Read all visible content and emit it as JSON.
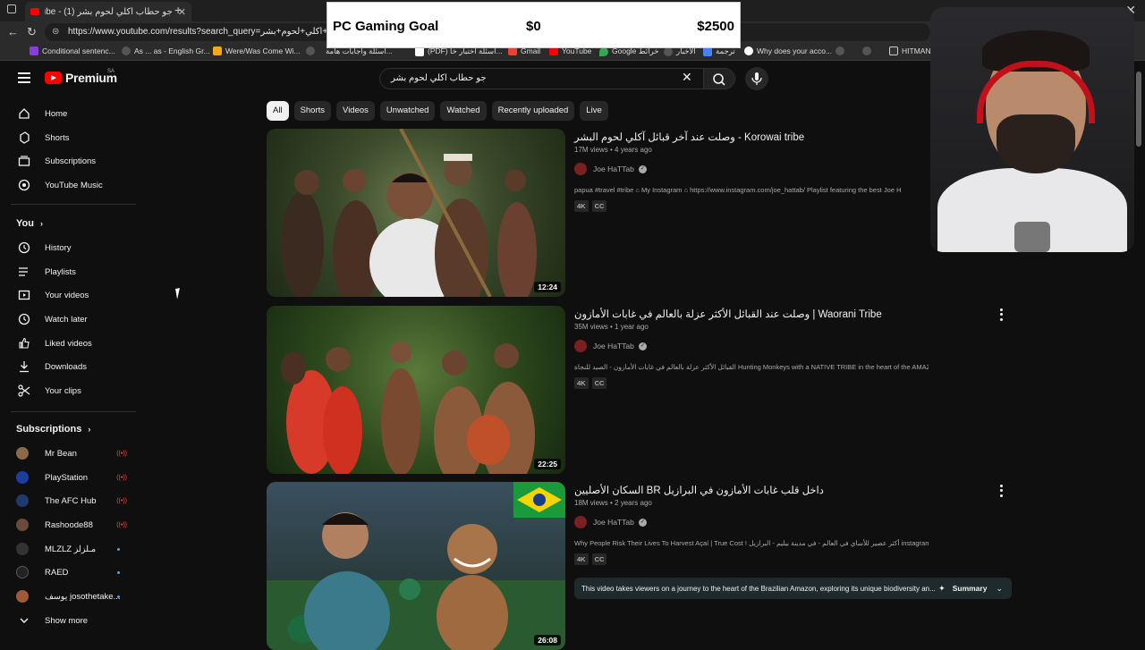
{
  "browser": {
    "tab_title": "جو حطاب اكلي لحوم بشر (1) - YouTube",
    "url": "https://www.youtube.com/results?search_query=جو+حطاب+اكلي+لحوم+بشر",
    "bookmarks": [
      "Conditional sentenc...",
      "As ... as - English Gr...",
      "Were/Was Come Wi...",
      "اسئلة واجابات هامة...",
      "(PDF) اسئلة اختبار خا...",
      "Gmail",
      "YouTube",
      "Google خرائط",
      "الأخبار",
      "ترجمة",
      "Why does your acco...",
      "HITMAN"
    ]
  },
  "goal": {
    "title": "PC Gaming Goal",
    "current": "$0",
    "target": "$2500"
  },
  "header": {
    "brand": "Premium",
    "region": "SA",
    "search_value": "جو حطاب اكلي لحوم بشر"
  },
  "sidebar": {
    "main": [
      "Home",
      "Shorts",
      "Subscriptions",
      "YouTube Music"
    ],
    "you_heading": "You",
    "you_items": [
      "History",
      "Playlists",
      "Your videos",
      "Watch later",
      "Liked videos",
      "Downloads",
      "Your clips"
    ],
    "subs_heading": "Subscriptions",
    "subscriptions": [
      {
        "name": "Mr Bean",
        "status": "live",
        "color": "#8a6a4a"
      },
      {
        "name": "PlayStation",
        "status": "live",
        "color": "#1b3fa0"
      },
      {
        "name": "The AFC Hub",
        "status": "live",
        "color": "#1e3a6e"
      },
      {
        "name": "Rashoode88",
        "status": "live",
        "color": "#6b4a3a"
      },
      {
        "name": "MLZLZ مـلزلز",
        "status": "new",
        "color": "#333333"
      },
      {
        "name": "RAED",
        "status": "new",
        "color": "#222222"
      },
      {
        "name": "يوسف josothetake...",
        "status": "new",
        "color": "#a05a3a"
      }
    ],
    "show_more": "Show more"
  },
  "chips": [
    "All",
    "Shorts",
    "Videos",
    "Unwatched",
    "Watched",
    "Recently uploaded",
    "Live"
  ],
  "results": [
    {
      "title": "وصلت عند آخر قبائل آكلي لحوم البشر - Korowai tribe",
      "views": "17M views",
      "age": "4 years ago",
      "channel": "Joe HaTTab",
      "description": "papua #travel #tribe ⌂ My Instagram ⌂ https://www.instagram.com/joe_hattab/ Playlist featuring the best Joe H",
      "duration": "12:24",
      "badges": [
        "4K",
        "CC"
      ]
    },
    {
      "title": "وصلت عند القبائل الأكثر عزلة بالعالم في غابات الأمازون | Waorani Tribe",
      "views": "35M views",
      "age": "1 year ago",
      "channel": "Joe HaTTab",
      "description": "القبائل الأكثر عزلة بالعالم في غابات الأمازون - الصيد للنجاة Hunting Monkeys with a NATIVE TRIBE in the heart of the AMAZON ...",
      "duration": "22:25",
      "badges": [
        "4K",
        "CC"
      ]
    },
    {
      "title": "السكان الأصليين BR داخل قلب غابات الأمازون في البرازيل",
      "views": "18M views",
      "age": "2 years ago",
      "channel": "Joe HaTTab",
      "description": "Why People Risk Their Lives To Harvest Açaí | True Cost ! أكثر عصير للأساي في العالم - في مدينة بيليم - البرازيل instagram ...",
      "duration": "26:08",
      "badges": [
        "4K",
        "CC"
      ],
      "summary": "This video takes viewers on a journey to the heart of the Brazilian Amazon, exploring its unique biodiversity an...",
      "summary_button": "Summary"
    }
  ]
}
